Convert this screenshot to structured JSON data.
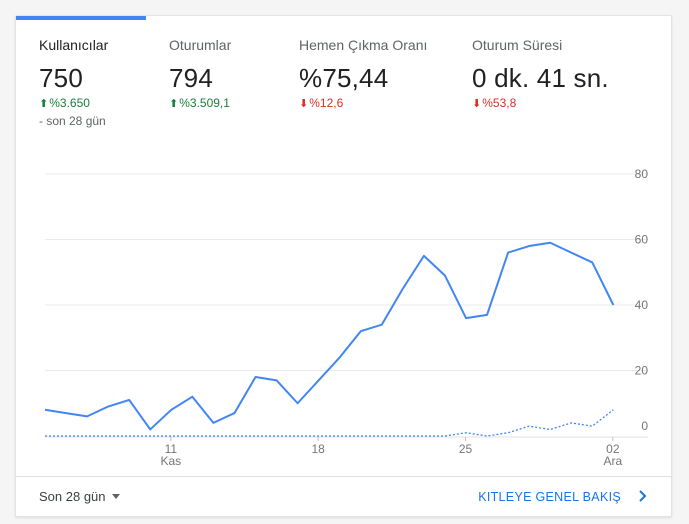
{
  "tabs": [
    {
      "label": "Kullanıcılar",
      "value": "750",
      "change": "%3.650",
      "direction": "up",
      "period": "- son 28 gün",
      "active": true
    },
    {
      "label": "Oturumlar",
      "value": "794",
      "change": "%3.509,1",
      "direction": "up",
      "active": false
    },
    {
      "label": "Hemen Çıkma Oranı",
      "value": "%75,44",
      "change": "%12,6",
      "direction": "down",
      "active": false
    },
    {
      "label": "Oturum Süresi",
      "value": "0 dk. 41 sn.",
      "change": "%53,8",
      "direction": "down",
      "active": false
    }
  ],
  "colors": {
    "accent": "#4285f4",
    "up": "#188038",
    "down": "#d93025",
    "link": "#1a73e8"
  },
  "footer": {
    "date_range": "Son 28 gün",
    "overview_link": "KITLEYE GENEL BAKIŞ"
  },
  "icons": {
    "date_range_caret": "caret-down-icon",
    "overview_arrow": "chevron-right-icon"
  },
  "chart_data": {
    "type": "line",
    "x_day_labels": [
      "11",
      "18",
      "25",
      "02"
    ],
    "x_month_labels": [
      "Kas",
      "",
      "",
      "Ara"
    ],
    "y_ticks": [
      0,
      20,
      40,
      60,
      80
    ],
    "ylim": [
      0,
      80
    ],
    "grid": true,
    "y_axis_side": "right",
    "series": [
      {
        "style": "solid",
        "color": "#4285f4",
        "values": [
          8,
          7,
          6,
          9,
          11,
          2,
          8,
          12,
          4,
          7,
          18,
          17,
          10,
          17,
          24,
          32,
          34,
          45,
          55,
          49,
          36,
          37,
          56,
          58,
          59,
          56,
          53,
          40
        ]
      },
      {
        "style": "dashed",
        "color": "#4285f4",
        "values": [
          0,
          0,
          0,
          0,
          0,
          0,
          0,
          0,
          0,
          0,
          0,
          0,
          0,
          0,
          0,
          0,
          0,
          0,
          0,
          0,
          1,
          0,
          1,
          3,
          2,
          4,
          3,
          8
        ]
      }
    ]
  }
}
